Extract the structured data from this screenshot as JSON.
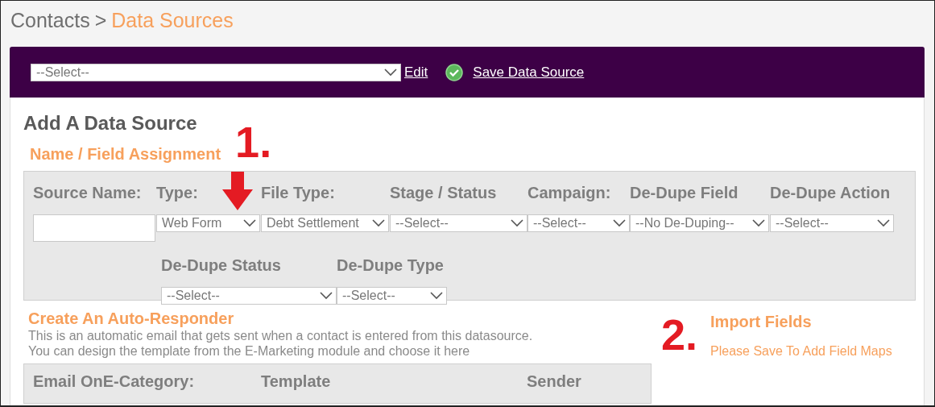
{
  "breadcrumb": {
    "parent": "Contacts",
    "separator": ">",
    "current": "Data Sources"
  },
  "toolbar": {
    "source_select": "--Select--",
    "edit_link": "Edit",
    "save_link": "Save Data Source"
  },
  "heading": "Add A Data Source",
  "field_assignment": {
    "title": "Name / Field Assignment",
    "step": "1.",
    "fields": [
      {
        "label": "Source Name:",
        "kind": "text"
      },
      {
        "label": "Type:",
        "kind": "select",
        "value": "Web Form"
      },
      {
        "label": "File Type:",
        "kind": "select",
        "value": "Debt Settlement"
      },
      {
        "label": "Stage / Status",
        "kind": "select",
        "value": "--Select--"
      },
      {
        "label": "Campaign:",
        "kind": "select",
        "value": "--Select--"
      },
      {
        "label": "De-Dupe Field",
        "kind": "select",
        "value": "--No De-Duping--"
      },
      {
        "label": "De-Dupe Action",
        "kind": "select",
        "value": "--Select--"
      }
    ],
    "second_row": [
      {
        "label": "De-Dupe Status",
        "kind": "select",
        "value": "--Select--"
      },
      {
        "label": "De-Dupe Type",
        "kind": "select",
        "value": "--Select--"
      }
    ]
  },
  "auto_responder": {
    "title": "Create An Auto-Responder",
    "description": [
      "This is an automatic email that gets sent when a contact is entered from this datasource.",
      "You can design the template from the E-Marketing module and choose it here"
    ],
    "columns": [
      "Email OnE-Category:",
      "Template",
      "Sender"
    ]
  },
  "import_fields": {
    "step": "2.",
    "title": "Import Fields",
    "note": "Please Save To Add Field Maps"
  }
}
